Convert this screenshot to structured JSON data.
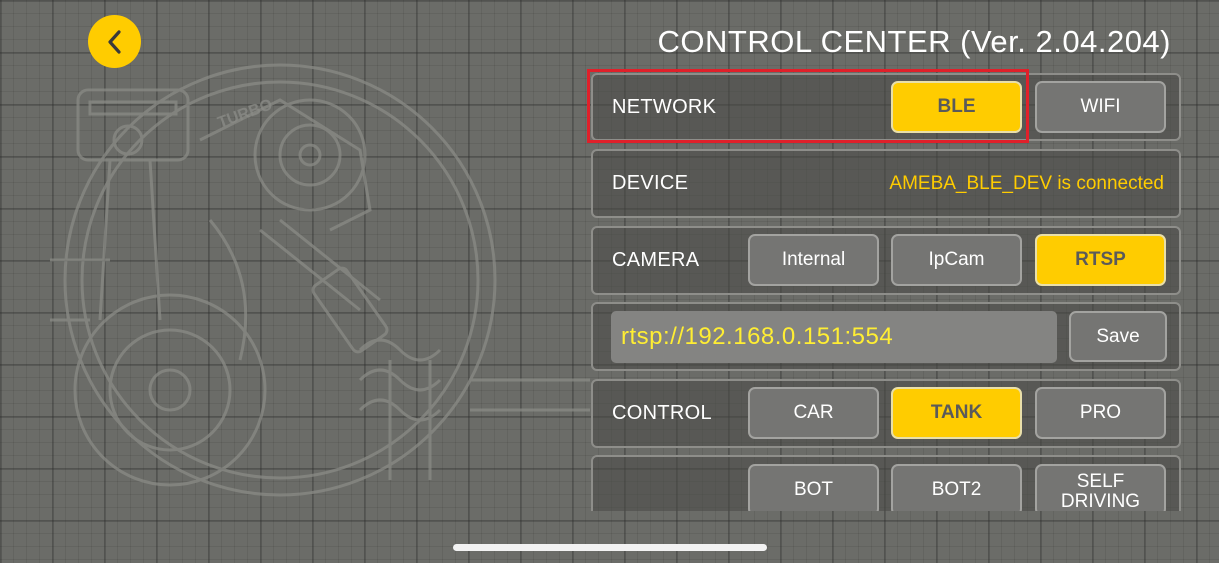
{
  "header": {
    "title": "CONTROL CENTER (Ver. 2.04.204)",
    "back_icon": "chevron-left-icon"
  },
  "network": {
    "label": "NETWORK",
    "options": [
      "BLE",
      "WIFI"
    ],
    "selected": "BLE"
  },
  "device": {
    "label": "DEVICE",
    "status": "AMEBA_BLE_DEV is connected"
  },
  "camera": {
    "label": "CAMERA",
    "options": [
      "Internal",
      "IpCam",
      "RTSP"
    ],
    "selected": "RTSP"
  },
  "rtsp": {
    "url": "rtsp://192.168.0.151:554",
    "save_label": "Save"
  },
  "control": {
    "label": "CONTROL",
    "options": [
      "CAR",
      "TANK",
      "PRO"
    ],
    "selected": "TANK",
    "more_options": [
      "BOT",
      "BOT2",
      "SELF\nDRIVING"
    ]
  },
  "colors": {
    "accent": "#ffcc00",
    "highlight_border": "#e0202a",
    "background": "#6b6c68",
    "status_text": "#ffcc00",
    "url_text": "#ffee33"
  }
}
